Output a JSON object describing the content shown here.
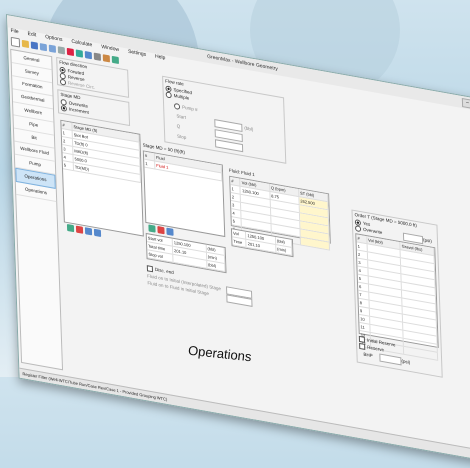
{
  "window": {
    "title": "GreenMax - Wellbore Geometry"
  },
  "menu": [
    "File",
    "Edit",
    "Options",
    "Calculate",
    "Window",
    "Settings",
    "Help"
  ],
  "nav": {
    "items": [
      "General",
      "Survey",
      "Formation",
      "Geothermal",
      "Wellbore",
      "Pipe",
      "Bit",
      "Wellbore Fluid",
      "Pump",
      "Operations",
      "Operations"
    ],
    "active_index": 9
  },
  "flow_direction": {
    "title": "Flow direction",
    "options": [
      "Forward",
      "Reverse",
      "Reverse Circ."
    ],
    "selected": 0
  },
  "flow_rate": {
    "title": "Flow rate",
    "options": [
      "Specified",
      "Multiple"
    ],
    "selected": 0
  },
  "pump": {
    "label": "Pump #",
    "rows": [
      "Start",
      "Q",
      "Stop"
    ],
    "unit": "(bbl)"
  },
  "stage_mo": {
    "title": "Stage MD",
    "options": [
      "Overwrite",
      "Increment"
    ],
    "selected": 1
  },
  "left_grid": {
    "header": [
      "#",
      "Stage MD (ft)"
    ],
    "rows": [
      [
        "1",
        "Slot Bot"
      ],
      [
        "2",
        "TD(ft) 0"
      ],
      [
        "3",
        "MAD(ft)"
      ],
      [
        "4",
        "5000.0"
      ],
      [
        "5",
        "TD(MD)"
      ]
    ]
  },
  "mid_grid": {
    "title": "Stage MD = 50 (ft)(ft)",
    "header": [
      "#",
      "Fluid"
    ],
    "rows": [
      [
        "1",
        "Fluid 1"
      ]
    ]
  },
  "mid_table": {
    "rows": [
      [
        "Start vol",
        "1250.100",
        "(bbl)"
      ],
      [
        "Total time",
        "201.10",
        "(min)"
      ],
      [
        "Stop vol",
        "",
        "(bbl)"
      ]
    ]
  },
  "disc_end": {
    "label": "Disc. end"
  },
  "fluid_options": [
    "Fluid on to Initial (Interpolated) Stage",
    "Fluid on to Fluid in Initial Stage"
  ],
  "right_grid": {
    "title": "Fluid: Fluid 1",
    "header": [
      "#",
      "Vol (bbl)",
      "Q (bpm)",
      "ST (bbl)"
    ],
    "rows": [
      [
        "1",
        "1250.100",
        "8.75",
        "262.500"
      ],
      [
        "2",
        "",
        "",
        ""
      ],
      [
        "3",
        "",
        "",
        ""
      ],
      [
        "4",
        "",
        "",
        ""
      ],
      [
        "5",
        "",
        "",
        ""
      ],
      [
        "6",
        "",
        "",
        ""
      ]
    ]
  },
  "right_sum": {
    "rows": [
      [
        "Vol",
        "1250.100",
        "(bbl)"
      ],
      [
        "Time",
        "201.10",
        "(min)"
      ]
    ]
  },
  "order": {
    "title": "Order T (Stage MD = 5000.0 ft)",
    "options": [
      "Yes",
      "Overwrite"
    ],
    "unit": "(psi)",
    "header": [
      "#",
      "Vol (bbl)",
      "Gravel (lbs)"
    ],
    "rows": [
      "1",
      "2",
      "3",
      "4",
      "5",
      "6",
      "7",
      "8",
      "9",
      "10",
      "11",
      "12",
      "13"
    ]
  },
  "bottom_right": {
    "chk1": "Initial Reserve",
    "chk2": "Reserve",
    "f1": "BHP",
    "f2": "Q",
    "u1": "(psi)",
    "u2": "(bpm)"
  },
  "status": "Register Filter (Well-WTC/Tube Run/Case Rev/Case 1 - Provided Grouping WTC)",
  "caption": "Operations"
}
